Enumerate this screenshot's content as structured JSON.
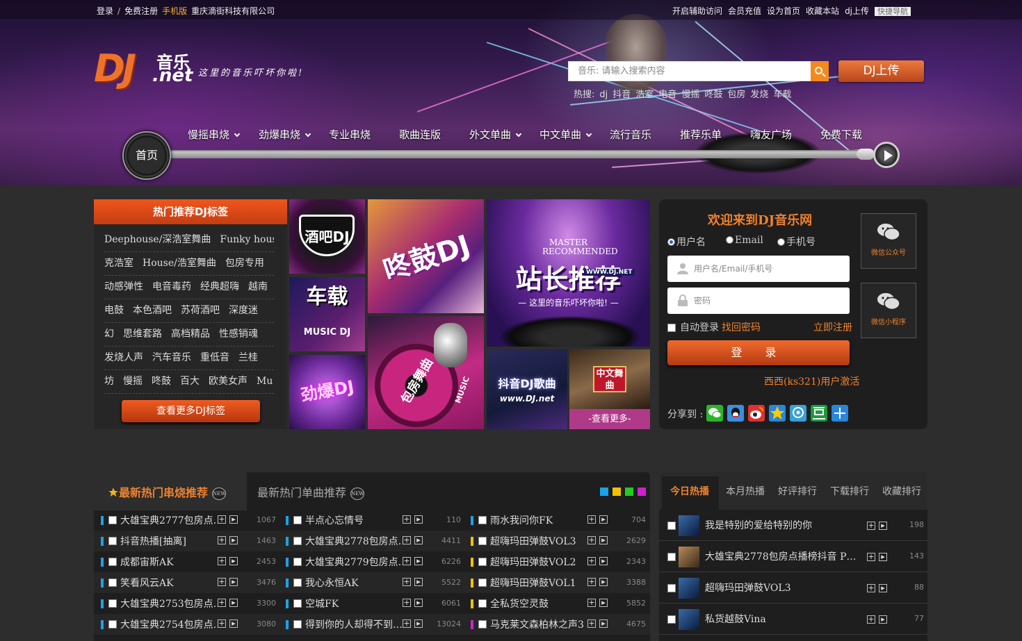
{
  "topbar": {
    "login": "登录",
    "sep": "/",
    "register": "免费注册",
    "mobile": "手机版",
    "company": "重庆滴街科技有限公司",
    "right_links": [
      "开启辅助访问",
      "会员充值",
      "设为首页",
      "收藏本站",
      "dj上传"
    ],
    "quicknav": "快捷导航"
  },
  "logo": {
    "dj": "DJ",
    "music": "音乐",
    "net": ".net",
    "slogan": "这里的音乐吓坏你啦!"
  },
  "search": {
    "placeholder": "音乐: 请输入搜索内容",
    "icon": "search-icon"
  },
  "upload_label": "DJ上传",
  "hot_search": {
    "label": "热搜:",
    "terms": [
      "dj",
      "抖音",
      "浩室",
      "电音",
      "慢摇",
      "咚鼓",
      "包房",
      "发烧",
      "车载"
    ]
  },
  "nav": {
    "home": "首页",
    "items": [
      "慢摇串烧",
      "劲爆串烧",
      "专业串烧",
      "歌曲连版",
      "外文单曲",
      "中文单曲",
      "流行音乐",
      "推荐乐单",
      "嗨友广场",
      "免费下载"
    ]
  },
  "tags": {
    "title": "热门推荐DJ标签",
    "rows": [
      [
        "Deephouse/深浩室舞曲",
        "Funky house/放"
      ],
      [
        "克浩室",
        "House/浩室舞曲",
        "包房专用"
      ],
      [
        "动感弹性",
        "电音毒药",
        "经典超嗨",
        "越南"
      ],
      [
        "电鼓",
        "本色酒吧",
        "苏荷酒吧",
        "深度迷"
      ],
      [
        "幻",
        "思维套路",
        "高档精品",
        "性感销魂"
      ],
      [
        "发烧人声",
        "汽车音乐",
        "重低音",
        "兰桂"
      ],
      [
        "坊",
        "慢摇",
        "咚鼓",
        "百大",
        "欧美女声",
        "Mu"
      ]
    ],
    "more": "查看更多DJ标签"
  },
  "tiles": {
    "t1": "酒吧DJ",
    "t2": "车载",
    "t2_sub": "MUSIC DJ",
    "t3": "劲爆DJ",
    "t4": "咚鼓DJ",
    "t5": "包房舞曲",
    "t5_sub": "MUSIC",
    "t6_top": "MASTER RECOMMENDED",
    "t6": "站长推荐",
    "t6_url": "WWW.DJ.NET",
    "t6_slogan": "— 这里的音乐吓坏你啦! —",
    "t7": "抖音DJ歌曲",
    "t7_url": "www.DJ.net",
    "t8": "中文舞曲",
    "more": "-查看更多-"
  },
  "login": {
    "title": "欢迎来到DJ音乐网",
    "radios": [
      "用户名",
      "Email",
      "手机号"
    ],
    "user_placeholder": "用户名/Email/手机号",
    "pass_placeholder": "密码",
    "autologin": "自动登录",
    "forgot": "找回密码",
    "register": "立即注册",
    "submit": "登 录",
    "activate": "西西(ks321)用户激活",
    "share": "分享到 :",
    "wechat_official": "微信公众号",
    "mini_program": "微信小程序"
  },
  "list_tabs": {
    "active": "最新热门串烧推荐",
    "inactive": "最新热门单曲推荐",
    "badge": "NEW"
  },
  "color_squares": [
    "#1aa3e8",
    "#f2c200",
    "#22cc22",
    "#cc22cc"
  ],
  "list": {
    "col1": [
      {
        "title": "大雄宝典2777包房点…",
        "count": "1067"
      },
      {
        "title": "抖音热播[抽离]",
        "count": "1463"
      },
      {
        "title": "成都宙斯AK",
        "count": "2453"
      },
      {
        "title": "笑看风云AK",
        "count": "3476"
      },
      {
        "title": "大雄宝典2753包房点…",
        "count": "3300"
      },
      {
        "title": "大雄宝典2754包房点…",
        "count": "3080"
      }
    ],
    "col2": [
      {
        "title": "半点心忘情号",
        "count": "110"
      },
      {
        "title": "大雄宝典2778包房点…",
        "count": "4411"
      },
      {
        "title": "大雄宝典2779包房点…",
        "count": "6226"
      },
      {
        "title": "我心永恒AK",
        "count": "5522"
      },
      {
        "title": "空城FK",
        "count": "6061"
      },
      {
        "title": "得到你的人却得不到…",
        "count": "13024"
      }
    ],
    "col3": [
      {
        "title": "雨水我问你FK",
        "count": "704"
      },
      {
        "title": "超嗨玛田弹鼓VOL3",
        "count": "2629"
      },
      {
        "title": "超嗨玛田弹鼓VOL2",
        "count": "2343"
      },
      {
        "title": "超嗨玛田弹鼓VOL1",
        "count": "3388"
      },
      {
        "title": "全私货空灵鼓",
        "count": "5852"
      },
      {
        "title": "马克莱文森柏林之声3",
        "count": "4675"
      }
    ]
  },
  "rank": {
    "tabs": [
      "今日热播",
      "本月热播",
      "好评排行",
      "下载排行",
      "收藏排行"
    ],
    "rows": [
      {
        "title": "我是特别的爱给特别的你",
        "count": "198"
      },
      {
        "title": "大雄宝典2778包房点播榜抖音 PRO…",
        "count": "143"
      },
      {
        "title": "超嗨玛田弹鼓VOL3",
        "count": "88"
      },
      {
        "title": "私货越鼓Vina",
        "count": "77"
      }
    ]
  },
  "colors": {
    "accent": "#f0812c",
    "orange_btn": "#f0561c",
    "bg": "#2d2d2d",
    "panel": "#1e1e1e"
  }
}
